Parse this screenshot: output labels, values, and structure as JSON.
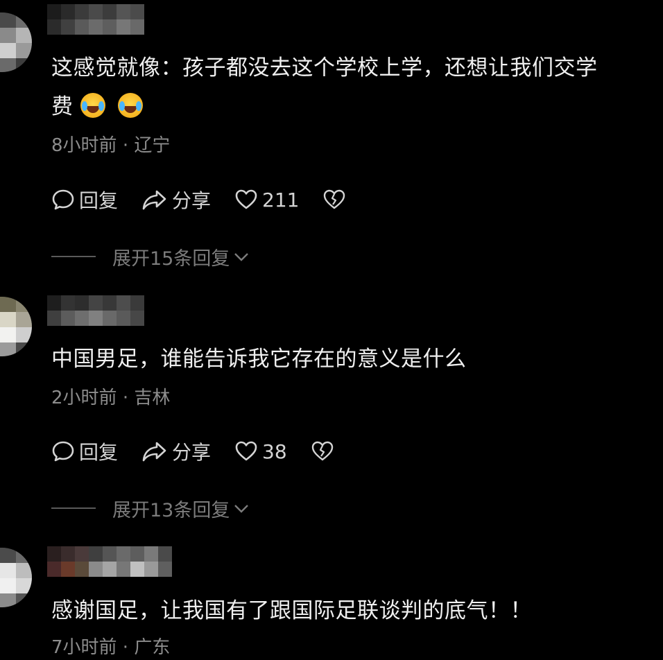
{
  "comments": [
    {
      "text": "这感觉就像：孩子都没去这个学校上学，还想让我们交学",
      "text_line2": "费",
      "emojis": [
        "crying-face",
        "crying-face"
      ],
      "time": "8小时前",
      "location": "辽宁",
      "reply_label": "回复",
      "share_label": "分享",
      "likes": "211",
      "expand_label": "展开15条回复"
    },
    {
      "text": "中国男足，谁能告诉我它存在的意义是什么",
      "time": "2小时前",
      "location": "吉林",
      "reply_label": "回复",
      "share_label": "分享",
      "likes": "38",
      "expand_label": "展开13条回复"
    },
    {
      "text": "感谢国足，让我国有了跟国际足联谈判的底气！！",
      "meta_partial": "7小时前 · 广东"
    }
  ],
  "meta_separator": "·",
  "icons": {
    "reply": "speech-bubble-icon",
    "share": "share-arrow-icon",
    "like": "heart-icon",
    "dislike": "broken-heart-icon",
    "expand": "chevron-down-icon"
  },
  "colors": {
    "background": "#000000",
    "text": "#efefef",
    "meta": "#8d8d8d",
    "action": "#d4d4d4"
  }
}
